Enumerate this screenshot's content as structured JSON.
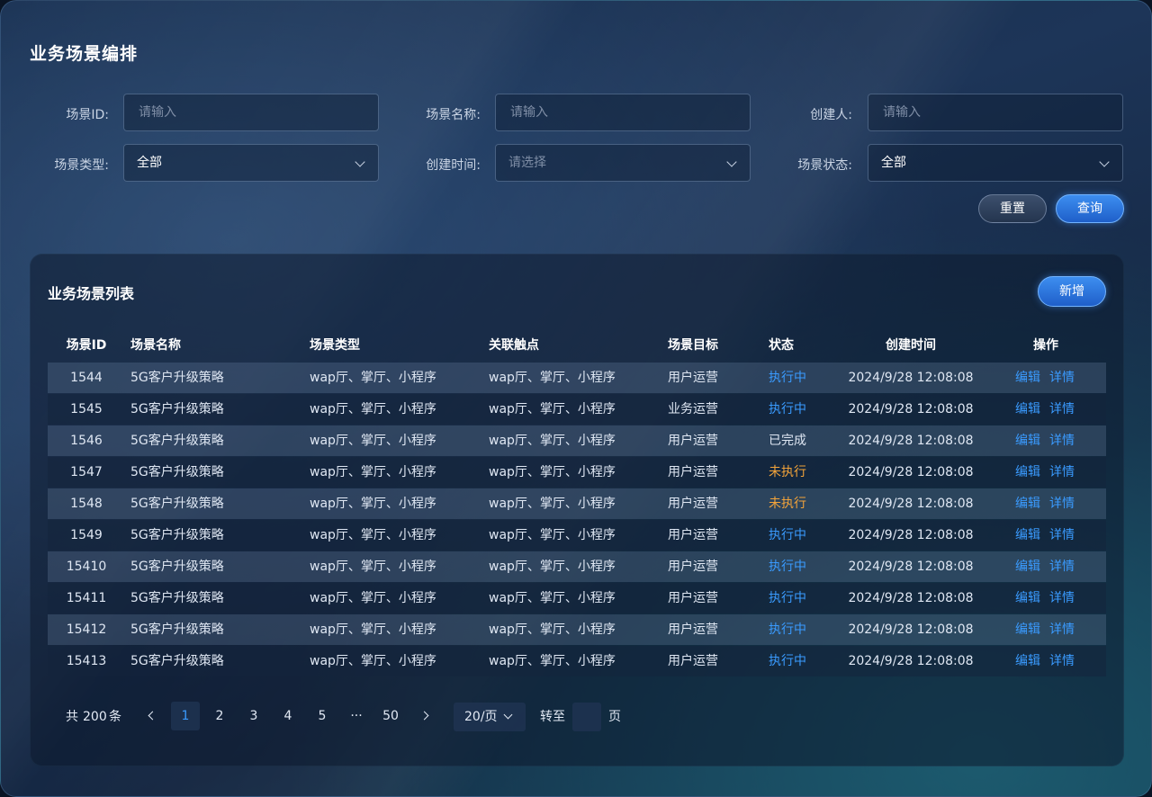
{
  "page": {
    "title": "业务场景编排"
  },
  "filters": {
    "scene_id": {
      "label": "场景ID:",
      "placeholder": "请输入"
    },
    "scene_name": {
      "label": "场景名称:",
      "placeholder": "请输入"
    },
    "creator": {
      "label": "创建人:",
      "placeholder": "请输入"
    },
    "scene_type": {
      "label": "场景类型:",
      "value": "全部"
    },
    "create_time": {
      "label": "创建时间:",
      "placeholder": "请选择"
    },
    "scene_status": {
      "label": "场景状态:",
      "value": "全部"
    }
  },
  "actions": {
    "reset_label": "重置",
    "query_label": "查询"
  },
  "table": {
    "title": "业务场景列表",
    "add_label": "新增",
    "columns": [
      "场景ID",
      "场景名称",
      "场景类型",
      "关联触点",
      "场景目标",
      "状态",
      "创建时间",
      "操作"
    ],
    "rows": [
      {
        "id": "1544",
        "name": "5G客户升级策略",
        "type": "wap厅、掌厅、小程序",
        "touch": "wap厅、掌厅、小程序",
        "goal": "用户运营",
        "status": "执行中",
        "time": "2024/9/28 12:08:08"
      },
      {
        "id": "1545",
        "name": "5G客户升级策略",
        "type": "wap厅、掌厅、小程序",
        "touch": "wap厅、掌厅、小程序",
        "goal": "业务运营",
        "status": "执行中",
        "time": "2024/9/28 12:08:08"
      },
      {
        "id": "1546",
        "name": "5G客户升级策略",
        "type": "wap厅、掌厅、小程序",
        "touch": "wap厅、掌厅、小程序",
        "goal": "用户运营",
        "status": "已完成",
        "time": "2024/9/28 12:08:08"
      },
      {
        "id": "1547",
        "name": "5G客户升级策略",
        "type": "wap厅、掌厅、小程序",
        "touch": "wap厅、掌厅、小程序",
        "goal": "用户运营",
        "status": "未执行",
        "time": "2024/9/28 12:08:08"
      },
      {
        "id": "1548",
        "name": "5G客户升级策略",
        "type": "wap厅、掌厅、小程序",
        "touch": "wap厅、掌厅、小程序",
        "goal": "用户运营",
        "status": "未执行",
        "time": "2024/9/28 12:08:08"
      },
      {
        "id": "1549",
        "name": "5G客户升级策略",
        "type": "wap厅、掌厅、小程序",
        "touch": "wap厅、掌厅、小程序",
        "goal": "用户运营",
        "status": "执行中",
        "time": "2024/9/28 12:08:08"
      },
      {
        "id": "15410",
        "name": "5G客户升级策略",
        "type": "wap厅、掌厅、小程序",
        "touch": "wap厅、掌厅、小程序",
        "goal": "用户运营",
        "status": "执行中",
        "time": "2024/9/28 12:08:08"
      },
      {
        "id": "15411",
        "name": "5G客户升级策略",
        "type": "wap厅、掌厅、小程序",
        "touch": "wap厅、掌厅、小程序",
        "goal": "用户运营",
        "status": "执行中",
        "time": "2024/9/28 12:08:08"
      },
      {
        "id": "15412",
        "name": "5G客户升级策略",
        "type": "wap厅、掌厅、小程序",
        "touch": "wap厅、掌厅、小程序",
        "goal": "用户运营",
        "status": "执行中",
        "time": "2024/9/28 12:08:08"
      },
      {
        "id": "15413",
        "name": "5G客户升级策略",
        "type": "wap厅、掌厅、小程序",
        "touch": "wap厅、掌厅、小程序",
        "goal": "用户运营",
        "status": "执行中",
        "time": "2024/9/28 12:08:08"
      }
    ],
    "ops": {
      "edit": "编辑",
      "detail": "详情"
    }
  },
  "pagination": {
    "total_prefix": "共",
    "total": "200",
    "total_suffix": "条",
    "pages": [
      "1",
      "2",
      "3",
      "4",
      "5"
    ],
    "ellipsis": "···",
    "last_page": "50",
    "current_page": 1,
    "page_size": "20/页",
    "jump_label": "转至",
    "jump_suffix": "页"
  },
  "colors": {
    "accent": "#3a9bff",
    "status_running": "#3a9bff",
    "status_pending": "#f2a33a",
    "status_done": "#dfe7f3"
  }
}
